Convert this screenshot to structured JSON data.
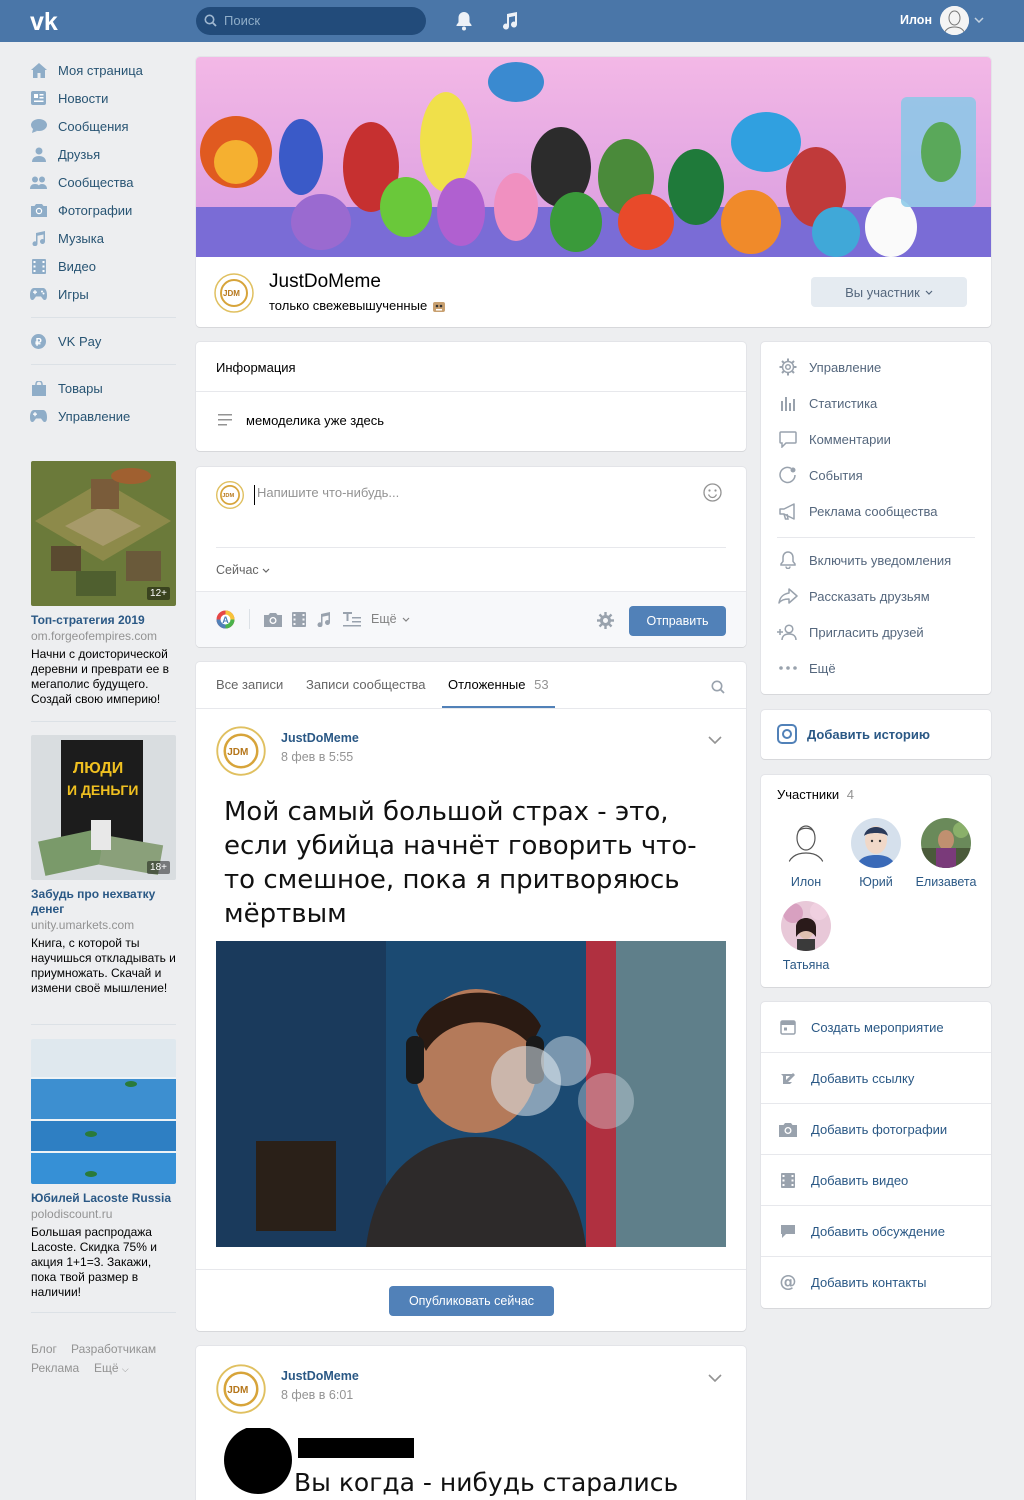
{
  "topbar": {
    "search_placeholder": "Поиск",
    "user_name": "Илон",
    "icons": [
      "vk-logo-icon",
      "search-icon",
      "bell-icon",
      "music-icon",
      "chevron-down-icon"
    ]
  },
  "left_nav": {
    "items": [
      {
        "label": "Моя страница",
        "icon": "home-icon"
      },
      {
        "label": "Новости",
        "icon": "news-icon"
      },
      {
        "label": "Сообщения",
        "icon": "messages-icon"
      },
      {
        "label": "Друзья",
        "icon": "friends-icon"
      },
      {
        "label": "Сообщества",
        "icon": "communities-icon"
      },
      {
        "label": "Фотографии",
        "icon": "camera-icon"
      },
      {
        "label": "Музыка",
        "icon": "music-icon"
      },
      {
        "label": "Видео",
        "icon": "video-icon"
      },
      {
        "label": "Игры",
        "icon": "gamepad-icon"
      }
    ],
    "vkpay": "VK Pay",
    "goods": "Товары",
    "manage": "Управление"
  },
  "ads": [
    {
      "title": "Топ-стратегия 2019",
      "domain": "om.forgeofempires.com",
      "text": "Начни с доисторической деревни и преврати ее в мегаполис будущего. Создай свою империю!",
      "age": "12+"
    },
    {
      "title": "Забудь про нехватку денег",
      "domain": "unity.umarkets.com",
      "text": "Книга, с которой ты научишься откладывать и приумножать. Скачай и измени своё мышление!",
      "age": "18+",
      "book_title": "ЛЮДИ И ДЕНЬГИ"
    },
    {
      "title": "Юбилей Lacoste Russia",
      "domain": "polodiscount.ru",
      "text": "Большая распродажа Lacoste. Скидка 75% и акция 1+1=3. Закажи, пока твой размер в наличии!"
    }
  ],
  "footer": {
    "blog": "Блог",
    "dev": "Разработчикам",
    "ads": "Реклама",
    "more": "Ещё"
  },
  "group": {
    "name": "JustDoMeme",
    "status": "только свежевышученные",
    "member_button": "Вы участник"
  },
  "info": {
    "title": "Информация",
    "description": "мемоделика уже здесь"
  },
  "composer": {
    "placeholder": "Напишите что-нибудь...",
    "time": "Сейчас",
    "more": "Ещё",
    "send": "Отправить"
  },
  "tabs": {
    "all": "Все записи",
    "community": "Записи сообщества",
    "postponed": "Отложенные",
    "postponed_count": "53"
  },
  "posts": [
    {
      "author": "JustDoMeme",
      "date": "8 фев в 5:55",
      "meme_text": "Мой самый большой страх - это, если убийца начнёт говорить что-то смешное, пока я притворяюсь мёртвым",
      "publish": "Опубликовать сейчас"
    },
    {
      "author": "JustDoMeme",
      "date": "8 фев в 6:01",
      "meme_text": "Вы когда - нибудь старались"
    }
  ],
  "right_menu": {
    "items": [
      {
        "label": "Управление",
        "icon": "gear-icon"
      },
      {
        "label": "Статистика",
        "icon": "stats-icon"
      },
      {
        "label": "Комментарии",
        "icon": "comment-icon"
      },
      {
        "label": "События",
        "icon": "events-icon"
      },
      {
        "label": "Реклама сообщества",
        "icon": "megaphone-icon"
      },
      {
        "label": "Включить уведомления",
        "icon": "bell-icon"
      },
      {
        "label": "Рассказать друзьям",
        "icon": "share-icon"
      },
      {
        "label": "Пригласить друзей",
        "icon": "invite-icon"
      },
      {
        "label": "Ещё",
        "icon": "more-icon"
      }
    ]
  },
  "story": {
    "label": "Добавить историю"
  },
  "members": {
    "title": "Участники",
    "count": "4",
    "list": [
      {
        "name": "Илон"
      },
      {
        "name": "Юрий"
      },
      {
        "name": "Елизавета"
      },
      {
        "name": "Татьяна"
      }
    ]
  },
  "actions": [
    {
      "label": "Создать мероприятие",
      "icon": "calendar-icon"
    },
    {
      "label": "Добавить ссылку",
      "icon": "link-icon"
    },
    {
      "label": "Добавить фотографии",
      "icon": "camera-icon"
    },
    {
      "label": "Добавить видео",
      "icon": "video-icon"
    },
    {
      "label": "Добавить обсуждение",
      "icon": "discussion-icon"
    },
    {
      "label": "Добавить контакты",
      "icon": "at-icon"
    }
  ],
  "colors": {
    "header": "#4a76a8",
    "link": "#2a5885",
    "button": "#5181b8",
    "bg": "#edeef0"
  }
}
